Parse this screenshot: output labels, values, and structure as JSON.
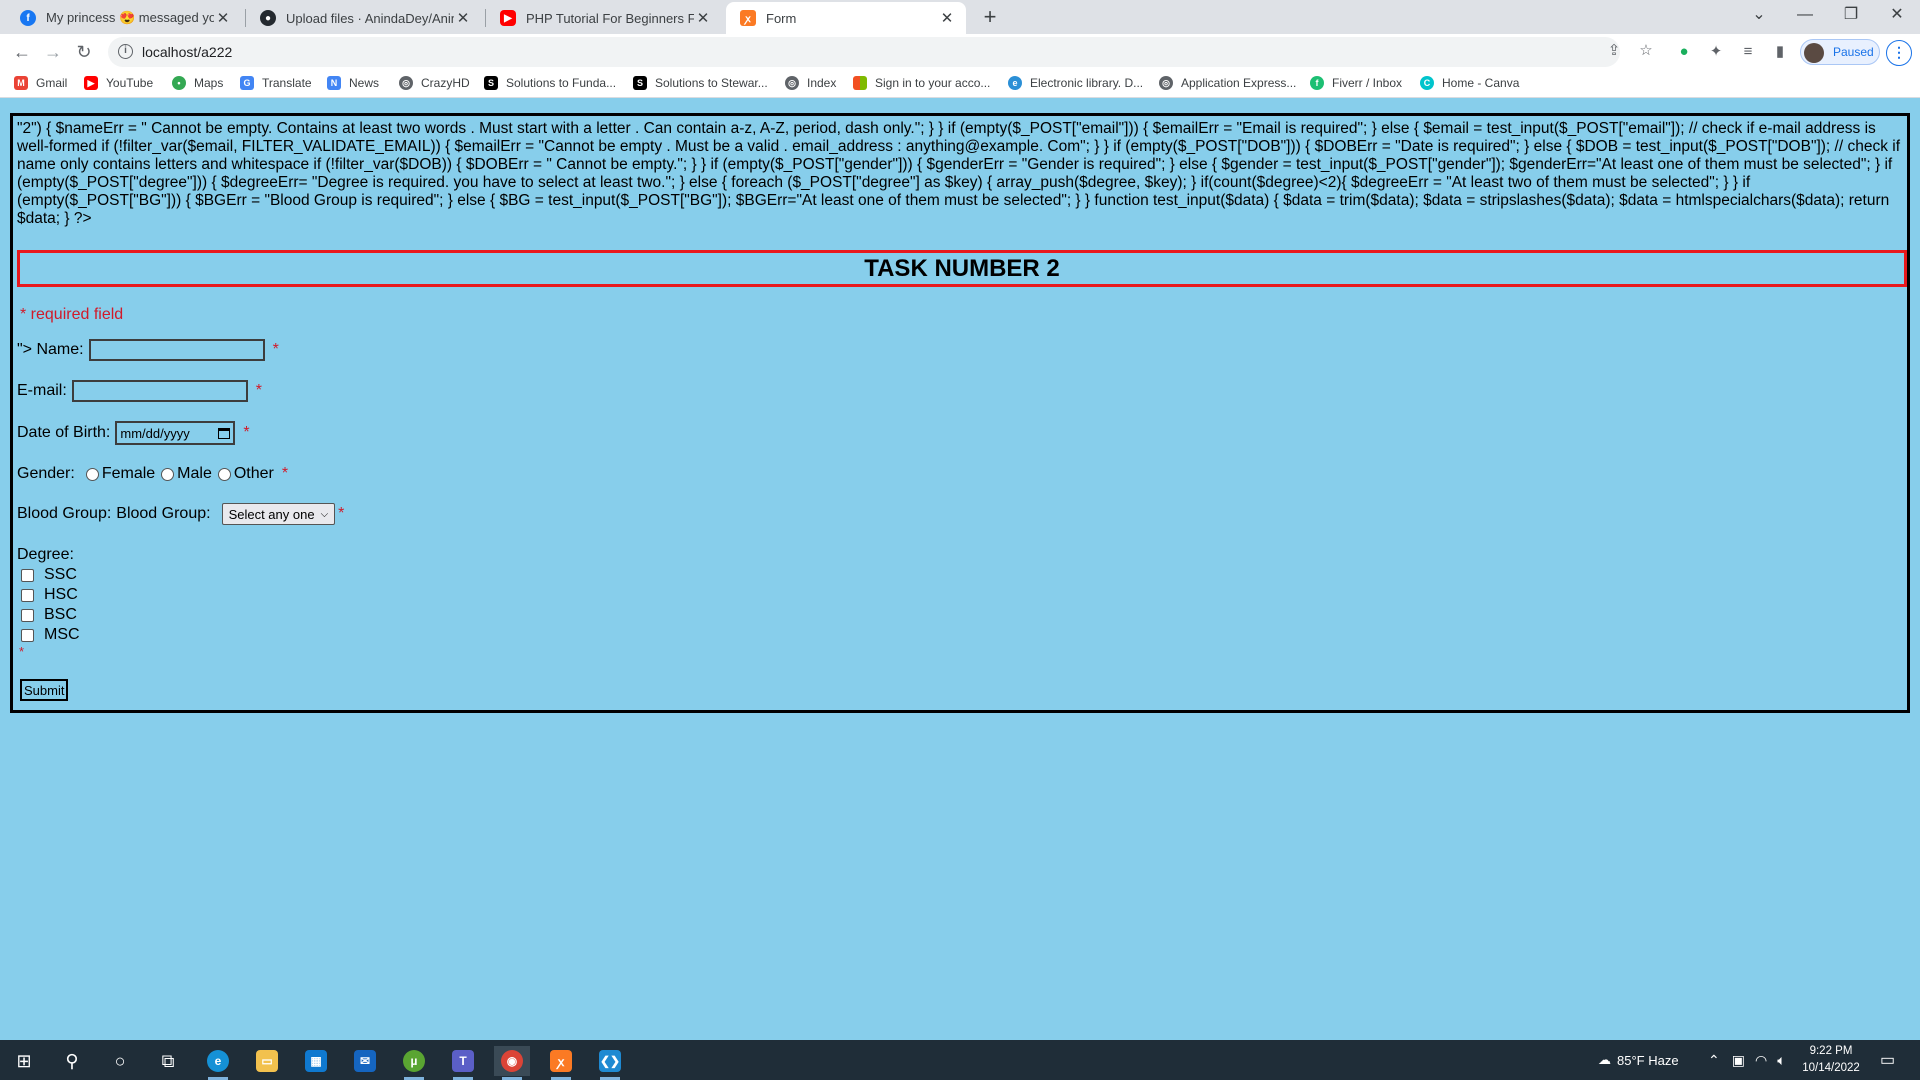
{
  "browser": {
    "tabs": [
      {
        "label": "My princess 😍 messaged you",
        "icon": "facebook-icon",
        "color": "#1877f2",
        "active": false
      },
      {
        "label": "Upload files · AnindaDey/Aninda",
        "icon": "github-icon",
        "color": "#24292f",
        "active": false
      },
      {
        "label": "PHP Tutorial For Beginners Full B",
        "icon": "youtube-icon",
        "color": "#ff0000",
        "active": false
      },
      {
        "label": "Form",
        "icon": "xampp-icon",
        "color": "#fb7a24",
        "active": true
      }
    ],
    "url": "localhost/a222",
    "profile_label": "Paused",
    "bookmarks": [
      {
        "label": "Gmail",
        "icon": "gmail-icon",
        "color": "#ea4335"
      },
      {
        "label": "YouTube",
        "icon": "youtube-icon",
        "color": "#ff0000"
      },
      {
        "label": "Maps",
        "icon": "maps-icon",
        "color": "#34a853"
      },
      {
        "label": "Translate",
        "icon": "translate-icon",
        "color": "#4285f4"
      },
      {
        "label": "News",
        "icon": "news-icon",
        "color": "#4285f4"
      },
      {
        "label": "CrazyHD",
        "icon": "globe-icon",
        "color": "#5f6368"
      },
      {
        "label": "Solutions to Funda...",
        "icon": "s-icon",
        "color": "#000000"
      },
      {
        "label": "Solutions to Stewar...",
        "icon": "s-icon",
        "color": "#000000"
      },
      {
        "label": "Index",
        "icon": "globe-icon",
        "color": "#5f6368"
      },
      {
        "label": "Sign in to your acco...",
        "icon": "microsoft-icon",
        "color": "#f25022"
      },
      {
        "label": "Electronic library. D...",
        "icon": "library-icon",
        "color": "#2b8fd6"
      },
      {
        "label": "Application Express...",
        "icon": "globe-icon",
        "color": "#5f6368"
      },
      {
        "label": "Fiverr / Inbox",
        "icon": "fiverr-icon",
        "color": "#1dbf73"
      },
      {
        "label": "Home - Canva",
        "icon": "canva-icon",
        "color": "#00c4cc"
      }
    ]
  },
  "page": {
    "php_dump": "\"2\") { $nameErr = \" Cannot be empty. Contains at least two words . Must start with a letter . Can contain a-z, A-Z, period, dash only.\"; } } if (empty($_POST[\"email\"])) { $emailErr = \"Email is required\"; } else { $email = test_input($_POST[\"email\"]); // check if e-mail address is well-formed if (!filter_var($email, FILTER_VALIDATE_EMAIL)) { $emailErr = \"Cannot be empty . Must be a valid . email_address : anything@example. Com\"; } } if (empty($_POST[\"DOB\"])) { $DOBErr = \"Date is required\"; } else { $DOB = test_input($_POST[\"DOB\"]); // check if name only contains letters and whitespace if (!filter_var($DOB)) { $DOBErr = \" Cannot be empty.\"; } } if (empty($_POST[\"gender\"])) { $genderErr = \"Gender is required\"; } else { $gender = test_input($_POST[\"gender\"]); $genderErr=\"At least one of them must be selected\"; } if (empty($_POST[\"degree\"])) { $degreeErr= \"Degree is required. you have to select at least two.\"; } else { foreach ($_POST[\"degree\"] as $key) { array_push($degree, $key); } if(count($degree)<2){ $degreeErr = \"At least two of them must be selected\"; } } if (empty($_POST[\"BG\"])) { $BGErr = \"Blood Group is required\"; } else { $BG = test_input($_POST[\"BG\"]); $BGErr=\"At least one of them must be selected\"; } } function test_input($data) { $data = trim($data); $data = stripslashes($data); $data = htmlspecialchars($data); return $data; } ?>",
    "heading": "TASK NUMBER 2",
    "required_note": "* required field",
    "star": "*",
    "name_label": "\"> Name:",
    "name_value": "",
    "email_label": "E-mail:",
    "email_value": "",
    "dob_label": "Date of Birth:",
    "dob_placeholder": "mm/dd/yyyy",
    "gender_label": "Gender:",
    "gender_options": [
      "Female",
      "Male",
      "Other"
    ],
    "blood_group_label": "Blood Group:",
    "blood_group_label_2": "Blood Group:",
    "blood_group_selected": "Select any one",
    "degree_label": "Degree:",
    "degree_options": [
      "SSC",
      "HSC",
      "BSC",
      "MSC"
    ],
    "submit_label": "Submit",
    "accent_colors": {
      "required": "#d11a2a",
      "heading_border": "#e8191d",
      "background": "#87ceeb"
    }
  },
  "taskbar": {
    "weather": "85°F  Haze",
    "time": "9:22 PM",
    "date": "10/14/2022",
    "apps": [
      "start-icon",
      "search-icon",
      "cortana-icon",
      "task-view-icon",
      "edge-icon",
      "file-explorer-icon",
      "store-icon",
      "mail-icon",
      "utorrent-icon",
      "teams-icon",
      "chrome-icon",
      "xampp-icon",
      "vscode-icon"
    ]
  }
}
